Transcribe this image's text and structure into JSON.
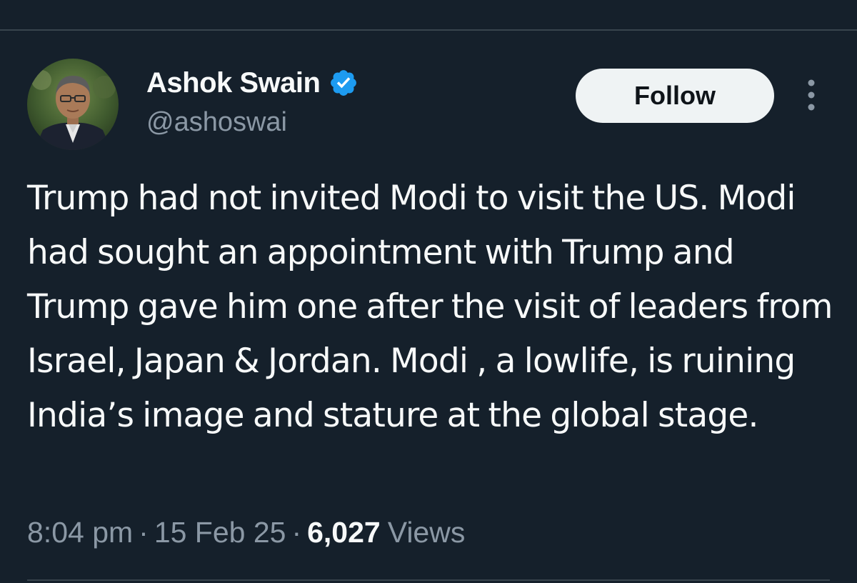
{
  "author": {
    "display_name": "Ashok Swain",
    "handle": "@ashoswai",
    "verified": true
  },
  "actions": {
    "follow_label": "Follow"
  },
  "tweet": {
    "text": "Trump had not invited Modi to visit the US. Modi had sought an appointment with Trump and Trump gave him one after the visit of leaders from Israel, Japan & Jordan. Modi , a lowlife, is ruining India’s image and stature at the global stage."
  },
  "meta": {
    "time": "8:04 pm",
    "separator": "·",
    "date": "15 Feb 25",
    "views_count": "6,027",
    "views_label": "Views"
  },
  "colors": {
    "background": "#15202b",
    "divider": "#38444d",
    "primary_text": "#f7f9f9",
    "secondary_text": "#8b98a5",
    "verified_badge": "#1d9bf0",
    "follow_button_bg": "#eff3f4",
    "follow_button_text": "#0f1419"
  },
  "icons": {
    "verified": "verified-badge-icon",
    "more": "more-options-icon"
  }
}
